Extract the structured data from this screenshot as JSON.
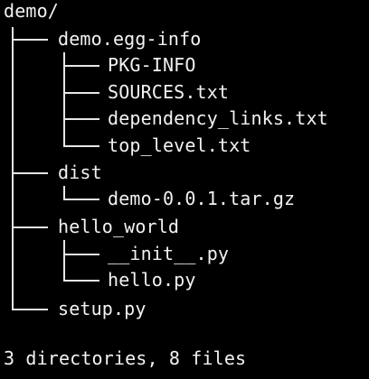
{
  "root": "demo/",
  "tree": {
    "egg_info": {
      "name": "demo.egg-info",
      "children": [
        "PKG-INFO",
        "SOURCES.txt",
        "dependency_links.txt",
        "top_level.txt"
      ]
    },
    "dist": {
      "name": "dist",
      "children": [
        "demo-0.0.1.tar.gz"
      ]
    },
    "hello_world": {
      "name": "hello_world",
      "children": [
        "__init__.py",
        "hello.py"
      ]
    },
    "setup": {
      "name": "setup.py"
    }
  },
  "summary": "3 directories, 8 files"
}
